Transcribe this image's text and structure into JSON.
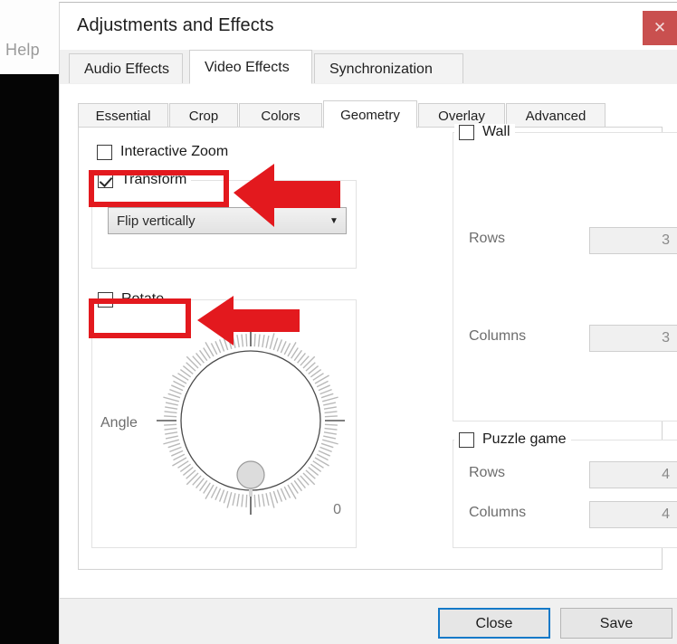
{
  "background": {
    "help_menu_label": "Help"
  },
  "window": {
    "title": "Adjustments and Effects",
    "close_icon": "close-x-icon",
    "close_label": "✕"
  },
  "tabs": {
    "items": [
      {
        "id": "audio",
        "label": "Audio Effects",
        "active": false
      },
      {
        "id": "video",
        "label": "Video Effects",
        "active": true
      },
      {
        "id": "sync",
        "label": "Synchronization",
        "active": false
      }
    ]
  },
  "subtabs": {
    "items": [
      {
        "id": "essential",
        "label": "Essential",
        "active": false
      },
      {
        "id": "crop",
        "label": "Crop",
        "active": false
      },
      {
        "id": "colors",
        "label": "Colors",
        "active": false
      },
      {
        "id": "geometry",
        "label": "Geometry",
        "active": true
      },
      {
        "id": "overlay",
        "label": "Overlay",
        "active": false
      },
      {
        "id": "advanced",
        "label": "Advanced",
        "active": false
      }
    ]
  },
  "geometry": {
    "interactive_zoom": {
      "label": "Interactive Zoom",
      "checked": false
    },
    "transform": {
      "label": "Transform",
      "checked": true,
      "mode_value": "Flip vertically",
      "dropdown_icon": "▼"
    },
    "rotate": {
      "label": "Rotate",
      "checked": false,
      "angle_label": "Angle",
      "angle_value": "0"
    },
    "wall": {
      "label": "Wall",
      "checked": false,
      "rows_label": "Rows",
      "rows_value": "3",
      "columns_label": "Columns",
      "columns_value": "3"
    },
    "puzzle": {
      "label": "Puzzle game",
      "checked": false,
      "rows_label": "Rows",
      "rows_value": "4",
      "columns_label": "Columns",
      "columns_value": "4"
    },
    "spinner_up_icon": "▲",
    "spinner_down_icon": "▼"
  },
  "footer": {
    "close_label": "Close",
    "save_label": "Save"
  },
  "annotations": {
    "color": "#E3191E",
    "highlight_boxes": [
      "Transform",
      "Rotate"
    ],
    "arrows": [
      "arrow-pointing-to-transform",
      "arrow-pointing-to-rotate"
    ]
  }
}
